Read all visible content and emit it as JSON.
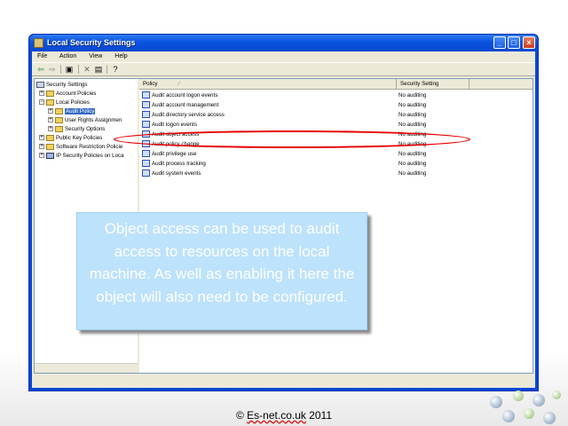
{
  "window": {
    "title": "Local Security Settings"
  },
  "menu": [
    "File",
    "Action",
    "View",
    "Help"
  ],
  "toolbar_icons": [
    "back-icon",
    "forward-icon",
    "up-folder-icon",
    "delete-icon",
    "properties-icon",
    "help-icon"
  ],
  "tree": {
    "items": [
      {
        "label": "Security Settings"
      },
      {
        "label": "Account Policies"
      },
      {
        "label": "Local Policies"
      },
      {
        "label": "Audit Policy"
      },
      {
        "label": "User Rights Assignmen"
      },
      {
        "label": "Security Options"
      },
      {
        "label": "Public Key Policies"
      },
      {
        "label": "Software Restriction Policie"
      },
      {
        "label": "IP Security Policies on Loca"
      }
    ]
  },
  "list": {
    "columns": [
      "Policy",
      "Security Setting"
    ],
    "sort_glyph": "⁄",
    "rows": [
      {
        "policy": "Audit account logon events",
        "setting": "No auditing"
      },
      {
        "policy": "Audit account management",
        "setting": "No auditing"
      },
      {
        "policy": "Audit directory service access",
        "setting": "No auditing"
      },
      {
        "policy": "Audit logon events",
        "setting": "No auditing"
      },
      {
        "policy": "Audit object access",
        "setting": "No auditing"
      },
      {
        "policy": "Audit policy change",
        "setting": "No auditing"
      },
      {
        "policy": "Audit privilege use",
        "setting": "No auditing"
      },
      {
        "policy": "Audit process tracking",
        "setting": "No auditing"
      },
      {
        "policy": "Audit system events",
        "setting": "No auditing"
      }
    ]
  },
  "callout": {
    "text": "Object access can be used to audit access to resources on the local machine. As well as enabling it here the object will also need to be configured."
  },
  "footer": {
    "prefix": "© ",
    "site": "Es-net.co.uk",
    "year": " 2011"
  },
  "colors": {
    "titlebar": "#0a52e0",
    "highlight_ellipse": "#e60000",
    "callout_bg": "#bde2fb"
  }
}
